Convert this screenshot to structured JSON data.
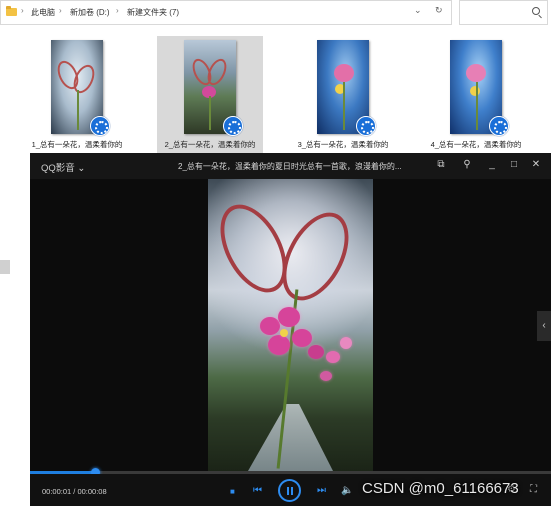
{
  "explorer": {
    "breadcrumbs": [
      "此电脑",
      "新加卷 (D:)",
      "新建文件夹 (7)"
    ],
    "refresh_icon": "refresh-icon",
    "dropdown_icon": "chevron-down-icon",
    "search_placeholder": ""
  },
  "files": [
    {
      "label": "1_总有一朵花，温柔着你的"
    },
    {
      "label": "2_总有一朵花，温柔着你的"
    },
    {
      "label": "3_总有一朵花，温柔着你的"
    },
    {
      "label": "4_总有一朵花，温柔着你的"
    }
  ],
  "player": {
    "brand": "QQ影音",
    "title": "2_总有一朵花，温柔着你的夏日时光总有一首歌，浪漫着你的...",
    "time": "00:00:01 / 00:00:08",
    "progress": 0.125,
    "accent": "#2d8cf0"
  },
  "watermark": "CSDN @m0_61166673"
}
